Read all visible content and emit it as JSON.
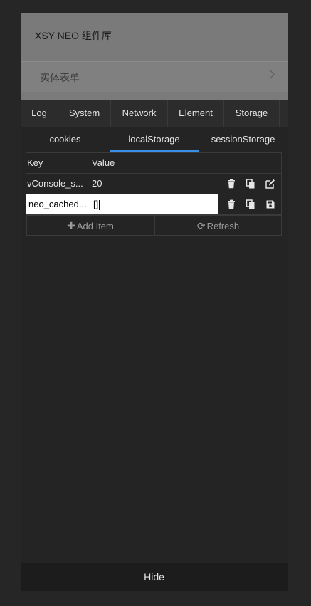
{
  "host": {
    "title": "XSY NEO 组件库",
    "row_label": "实体表单"
  },
  "tabs": [
    {
      "label": "Log"
    },
    {
      "label": "System"
    },
    {
      "label": "Network"
    },
    {
      "label": "Element"
    },
    {
      "label": "Storage"
    }
  ],
  "active_tab": "Storage",
  "storage_tabs": [
    {
      "label": "cookies"
    },
    {
      "label": "localStorage"
    },
    {
      "label": "sessionStorage"
    }
  ],
  "active_storage_tab": "localStorage",
  "table": {
    "header": {
      "key": "Key",
      "value": "Value"
    },
    "rows": [
      {
        "key": "vConsole_s...",
        "value": "20"
      },
      {
        "key": "neo_cached...",
        "value": "[]"
      }
    ]
  },
  "footer": {
    "add_label": "Add Item",
    "refresh_label": "Refresh"
  },
  "hide_label": "Hide",
  "colors": {
    "accent": "#3a8ee6",
    "panel_bg": "#242424",
    "text": "#e6e6e6"
  }
}
